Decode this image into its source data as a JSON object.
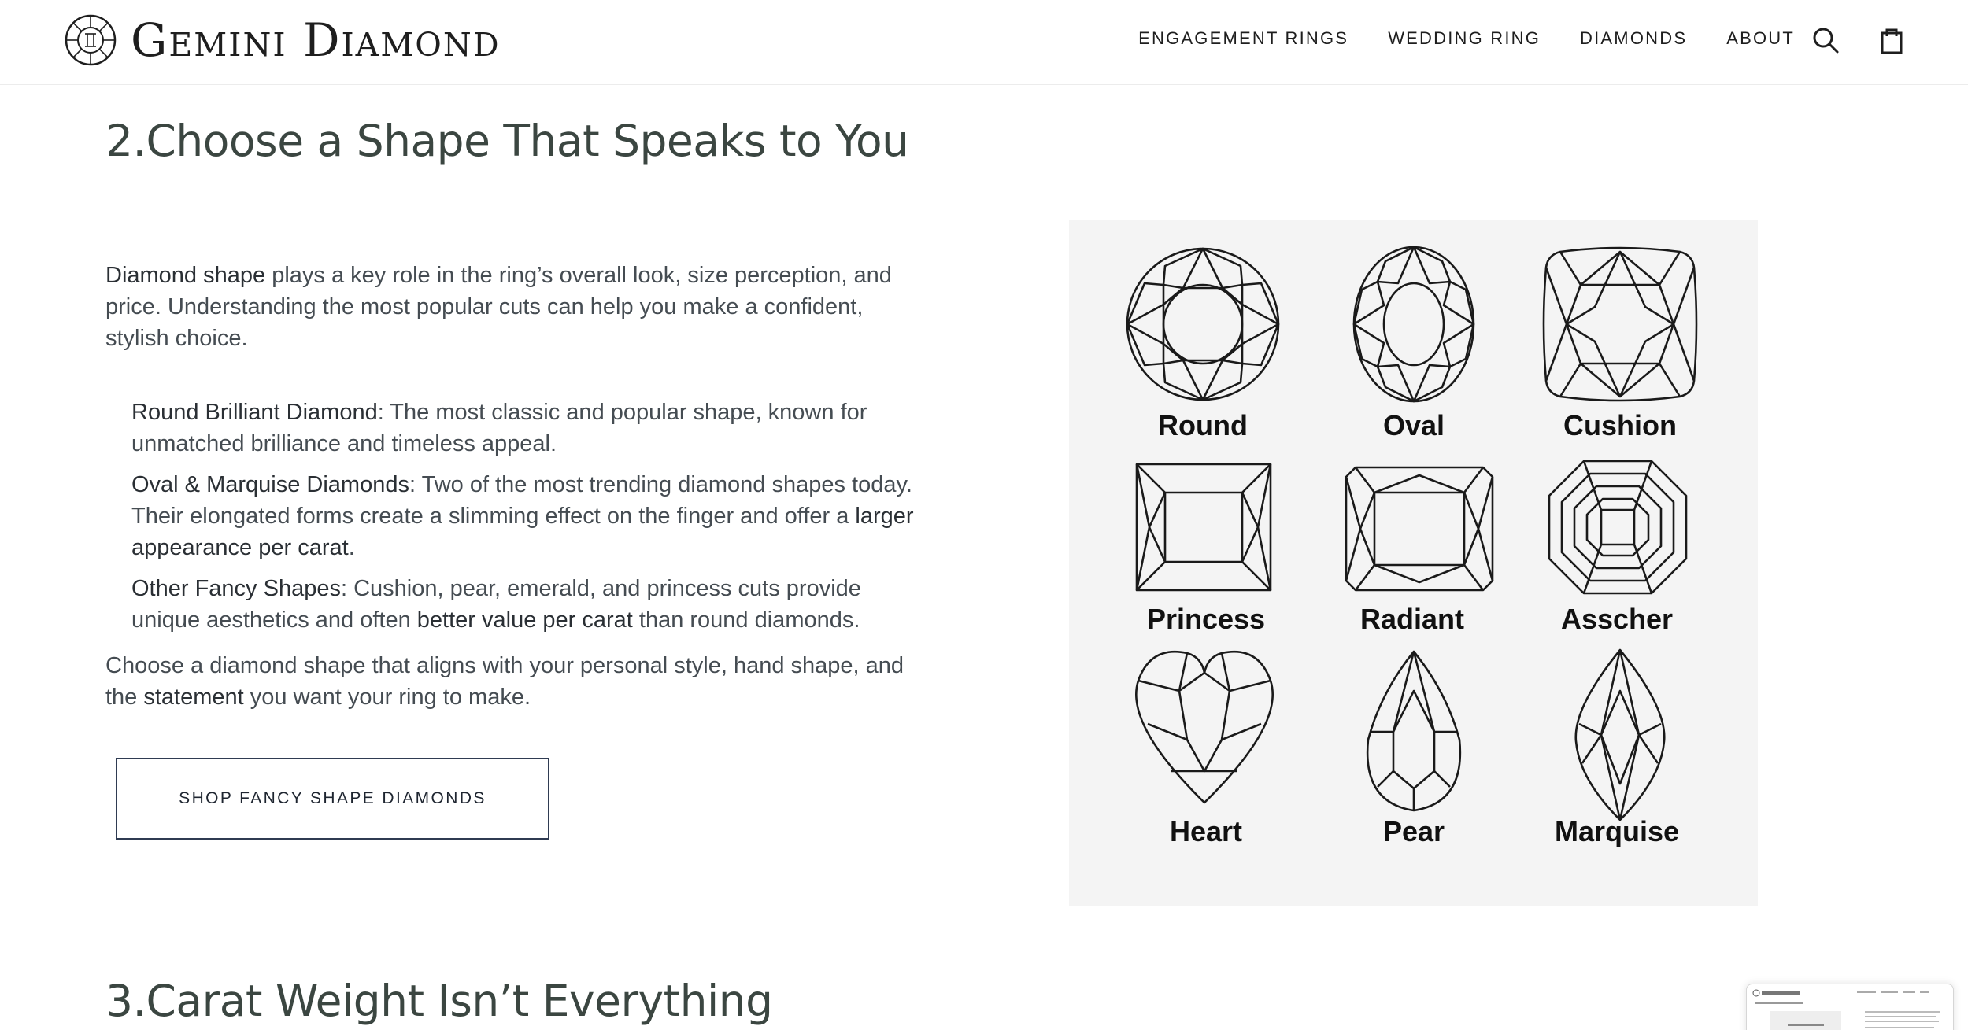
{
  "header": {
    "brand": "Gemini Diamond",
    "nav": [
      "ENGAGEMENT RINGS",
      "WEDDING RING",
      "DIAMONDS",
      "ABOUT"
    ],
    "icons": [
      "search-icon",
      "shopping-bag-icon"
    ]
  },
  "section2": {
    "title": "2.Choose a Shape That Speaks to You",
    "intro_bold": "Diamond shape",
    "intro_rest": " plays a key role in the ring’s overall look, size perception, and price. Understanding the most popular cuts can help you make a confident, stylish choice.",
    "items": [
      {
        "term": "Round Brilliant Diamond",
        "text": ": The most classic and popular shape, known for unmatched brilliance and timeless appeal."
      },
      {
        "term": "Oval & Marquise Diamonds",
        "text": ": Two of the most trending diamond shapes today. Their elongated forms create a slimming effect on the finger and offer a ",
        "bold2": "larger appearance per carat",
        "tail": "."
      },
      {
        "term": "Other Fancy Shapes",
        "text": ": Cushion, pear, emerald, and princess cuts provide unique aesthetics and often ",
        "bold2": "better value per carat",
        "tail": " than round diamonds."
      }
    ],
    "closing_pre": "Choose a diamond shape that aligns with your personal style, hand shape, and the ",
    "closing_bold": "statement",
    "closing_post": " you want your ring to make.",
    "cta": "SHOP FANCY SHAPE DIAMONDS",
    "shapes": [
      "Round",
      "Oval",
      "Cushion",
      "Princess",
      "Radiant",
      "Asscher",
      "Heart",
      "Pear",
      "Marquise"
    ]
  },
  "section3": {
    "title": "3.Carat Weight Isn’t Everything"
  },
  "colors": {
    "heading": "#3b4641",
    "body_text": "#454c52",
    "button_border": "#2f3b52",
    "panel_bg": "#f4f4f4"
  }
}
